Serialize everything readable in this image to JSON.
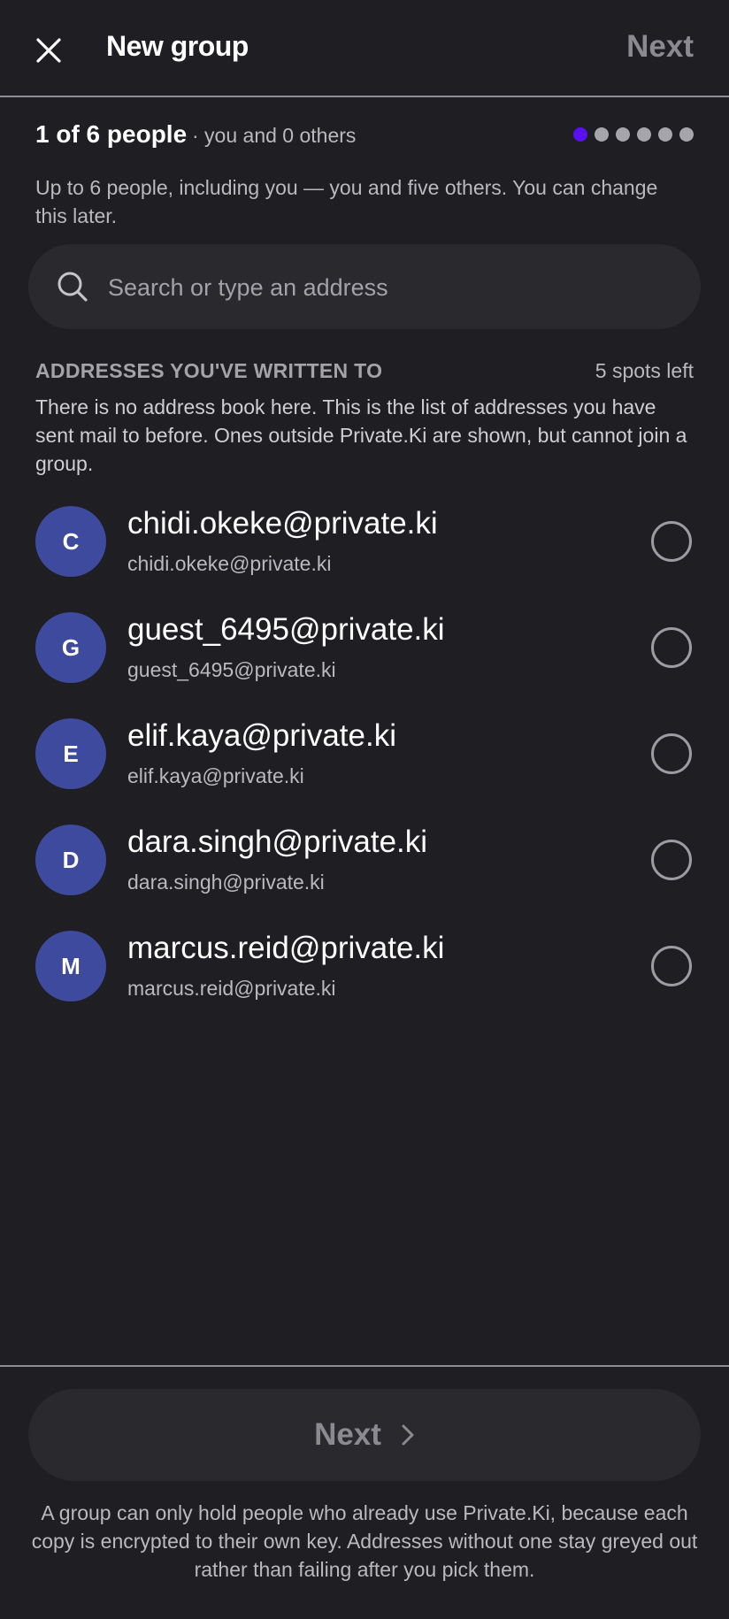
{
  "header": {
    "title": "New group",
    "next_label": "Next",
    "close_icon": "close-icon"
  },
  "group_count": {
    "main": "1 of 6 people",
    "sub": "· you and 0 others",
    "progress": {
      "filled": 1,
      "total": 6
    },
    "active_color": "#5b10f0"
  },
  "intro": "Up to 6 people, including you — you and five others. You can change this later.",
  "search": {
    "placeholder": "Search or type an address",
    "value": ""
  },
  "section": {
    "title": "ADDRESSES YOU'VE WRITTEN TO",
    "spots_left": "5 spots left",
    "note": "There is no address book here. This is the list of addresses you have sent mail to before. Ones outside Private.Ki are shown, but cannot join a group."
  },
  "contacts": [
    {
      "initial": "C",
      "name": "chidi.okeke@private.ki",
      "address": "chidi.okeke@private.ki",
      "selected": false
    },
    {
      "initial": "G",
      "name": "guest_6495@private.ki",
      "address": "guest_6495@private.ki",
      "selected": false
    },
    {
      "initial": "E",
      "name": "elif.kaya@private.ki",
      "address": "elif.kaya@private.ki",
      "selected": false
    },
    {
      "initial": "D",
      "name": "dara.singh@private.ki",
      "address": "dara.singh@private.ki",
      "selected": false
    },
    {
      "initial": "M",
      "name": "marcus.reid@private.ki",
      "address": "marcus.reid@private.ki",
      "selected": false
    }
  ],
  "footer": {
    "next_label": "Next",
    "note": "A group can only hold people who already use Private.Ki, because each copy is encrypted to their own key. Addresses without one stay greyed out rather than failing after you pick them."
  },
  "colors": {
    "background": "#1e1e23",
    "avatar": "#3e4a9e",
    "surface": "#29292e"
  }
}
